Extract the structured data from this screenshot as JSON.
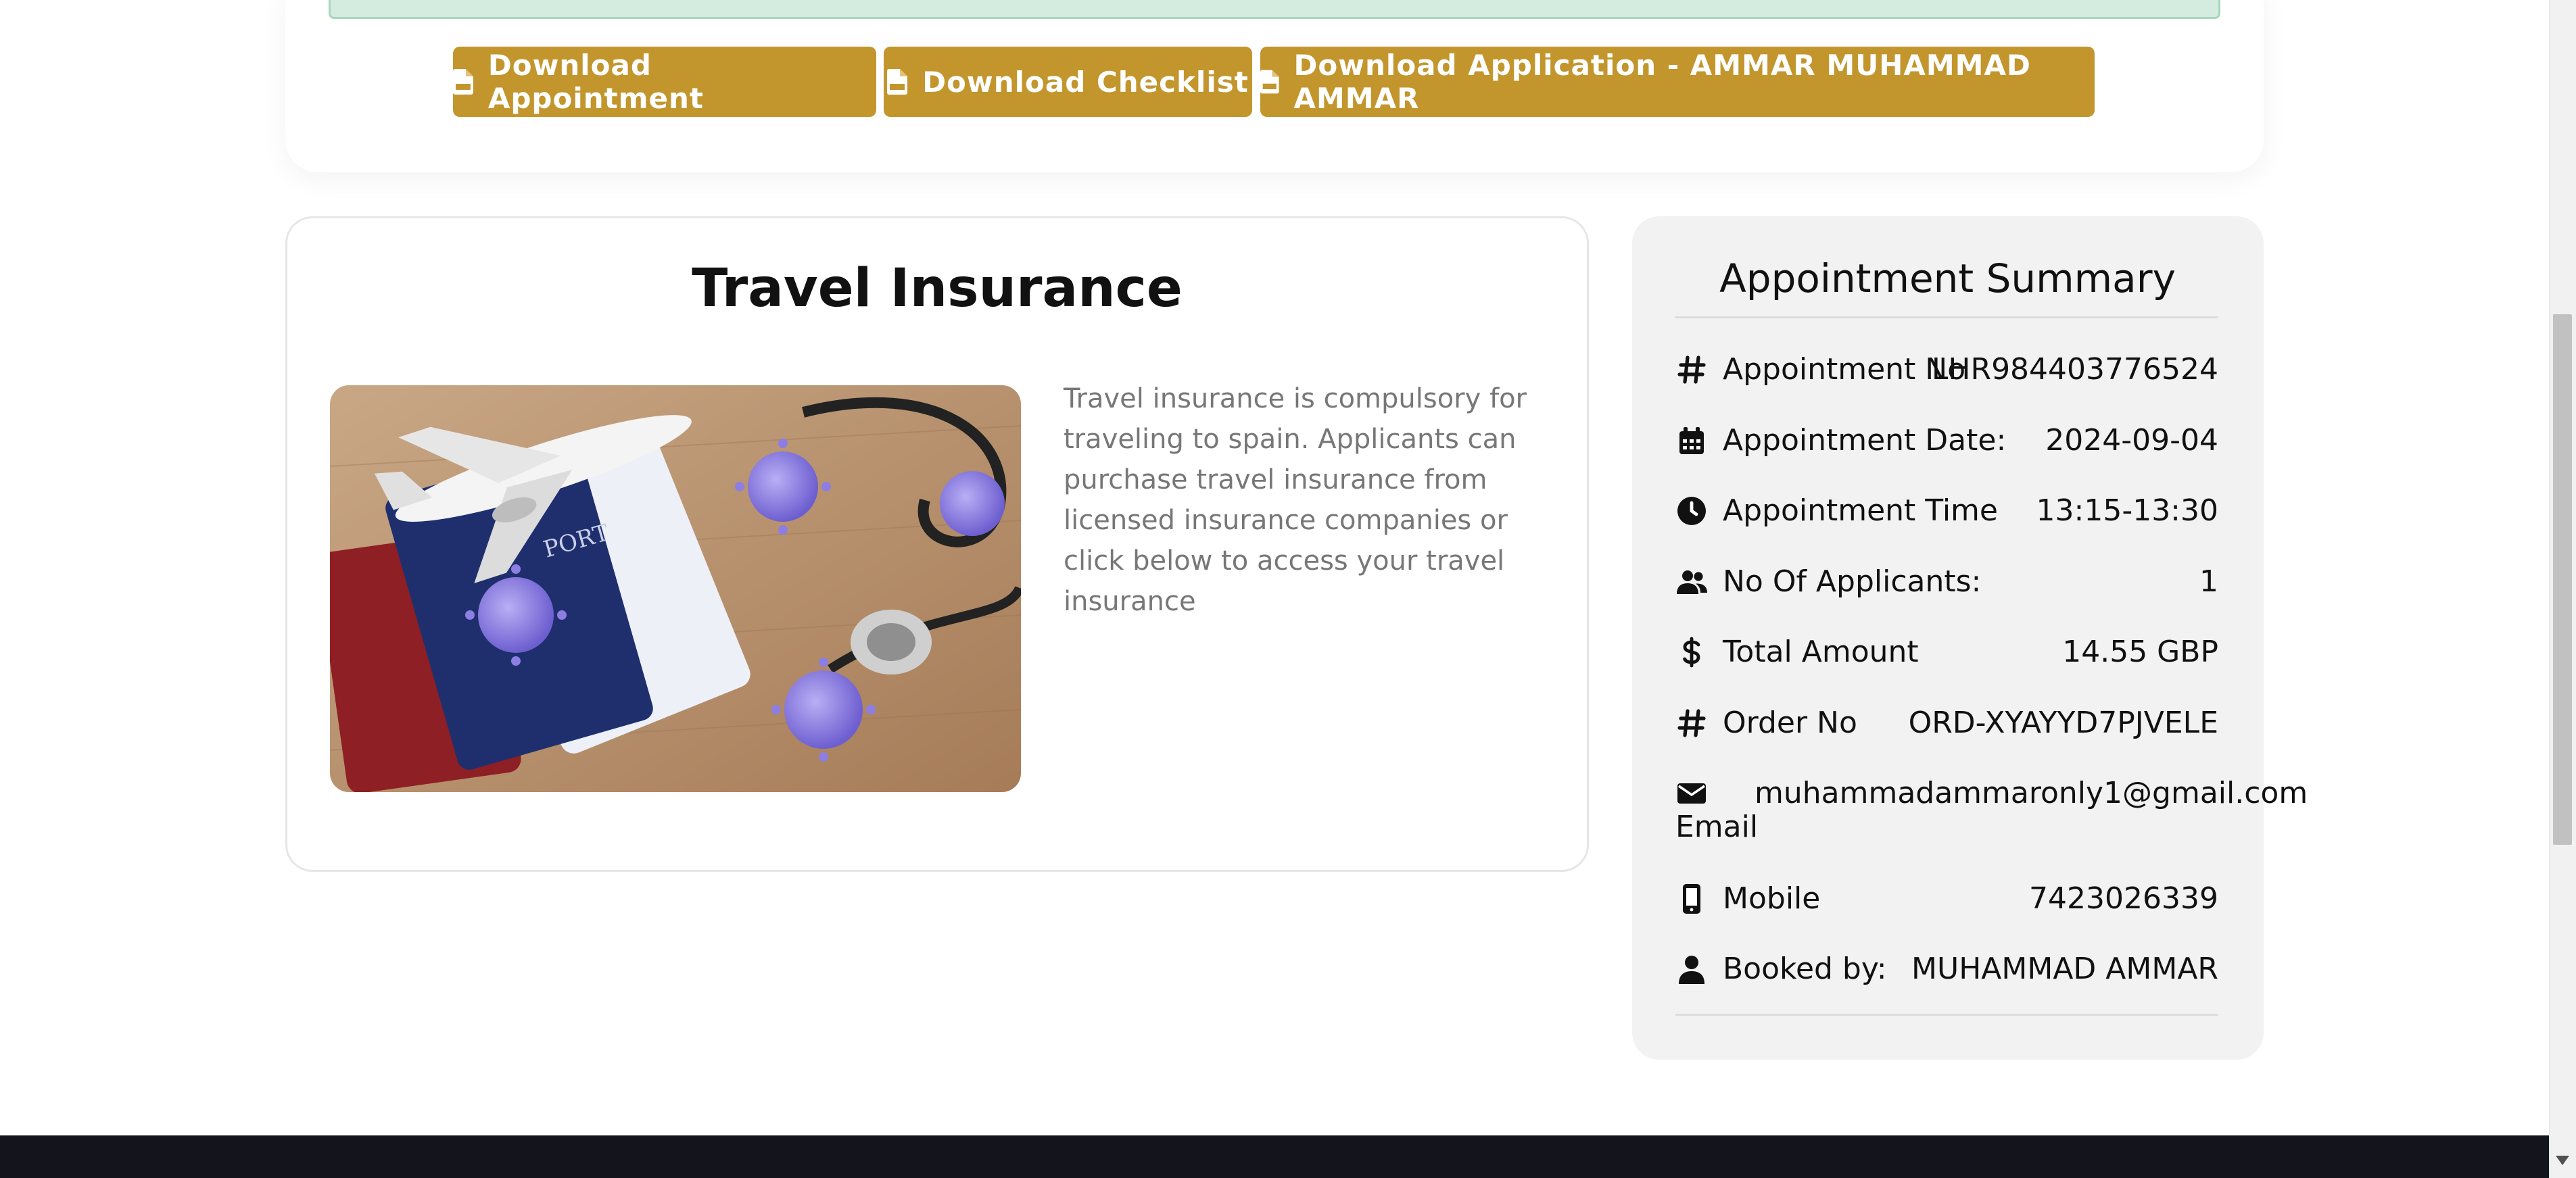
{
  "actions": {
    "download_appointment": "Download Appointment",
    "download_checklist": "Download Checklist",
    "download_application": "Download Application - AMMAR MUHAMMAD AMMAR"
  },
  "travel_insurance": {
    "title": "Travel Insurance",
    "description": "Travel insurance is compulsory for traveling to spain. Applicants can purchase travel insurance from licensed insurance companies or click below to access your travel insurance"
  },
  "summary": {
    "title": "Appointment Summary",
    "rows": [
      {
        "icon": "hash-icon",
        "label": "Appointment No",
        "value": "LHR984403776524"
      },
      {
        "icon": "calendar-icon",
        "label": "Appointment Date:",
        "value": "2024-09-04"
      },
      {
        "icon": "clock-icon",
        "label": "Appointment Time",
        "value": "13:15-13:30"
      },
      {
        "icon": "users-icon",
        "label": "No Of Applicants:",
        "value": "1"
      },
      {
        "icon": "dollar-icon",
        "label": "Total Amount",
        "value": "14.55 GBP"
      },
      {
        "icon": "hash-icon",
        "label": "Order No",
        "value": "ORD-XYAYYD7PJVELE"
      },
      {
        "icon": "envelope-icon",
        "label": "Email",
        "value": "muhammadammaronly1@gmail.com"
      },
      {
        "icon": "mobile-icon",
        "label": "Mobile",
        "value": "7423026339"
      },
      {
        "icon": "user-icon",
        "label": "Booked by:",
        "value": "MUHAMMAD AMMAR"
      }
    ]
  },
  "colors": {
    "accent": "#c2962d",
    "summary_bg": "#f2f2f2",
    "footer": "#14141c",
    "alert_bg": "#d4ecdf"
  }
}
